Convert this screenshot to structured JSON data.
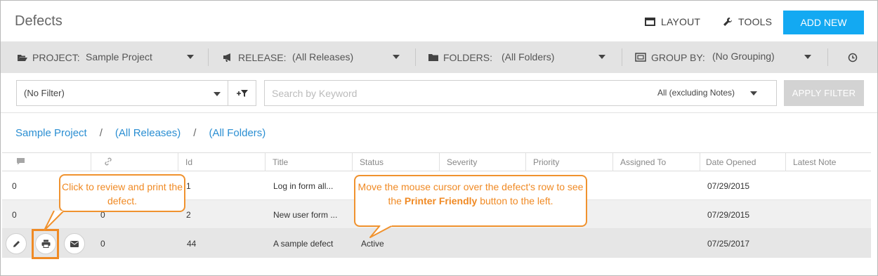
{
  "header": {
    "title": "Defects",
    "layout_label": "LAYOUT",
    "tools_label": "TOOLS",
    "add_new_label": "ADD NEW"
  },
  "filter_bar": {
    "project": {
      "label": "PROJECT:",
      "value": "Sample Project",
      "icon": "folder-open-icon"
    },
    "release": {
      "label": "RELEASE:",
      "value": "(All Releases)",
      "icon": "megaphone-icon"
    },
    "folders": {
      "label": "FOLDERS:",
      "value": "(All Folders)",
      "icon": "folder-icon"
    },
    "group_by": {
      "label": "GROUP BY:",
      "value": "(No Grouping)",
      "icon": "group-icon"
    },
    "history_icon": "clock-icon"
  },
  "search": {
    "filter_value": "(No Filter)",
    "placeholder": "Search by Keyword",
    "scope_value": "All (excluding Notes)",
    "apply_label": "APPLY FILTER"
  },
  "breadcrumb": {
    "items": [
      "Sample Project",
      "(All Releases)",
      "(All Folders)"
    ],
    "separator": "/"
  },
  "grid": {
    "columns": [
      "",
      "",
      "Id",
      "Title",
      "Status",
      "Severity",
      "Priority",
      "Assigned To",
      "Date Opened",
      "Latest Note"
    ],
    "rows": [
      {
        "comments": "0",
        "links": "",
        "id": "1",
        "title": "Log in form all...",
        "status": "",
        "date_opened": "07/29/2015"
      },
      {
        "comments": "0",
        "links": "0",
        "id": "2",
        "title": "New user form ...",
        "status": "",
        "date_opened": "07/29/2015"
      },
      {
        "comments": "",
        "links": "0",
        "id": "44",
        "title": "A sample defect",
        "status": "Active",
        "date_opened": "07/25/2017"
      }
    ]
  },
  "callouts": {
    "print_tip": "Click to review and print the defect.",
    "hover_tip_pre": "Move the mouse cursor over the defect's row to see the ",
    "hover_tip_bold": "Printer Friendly",
    "hover_tip_post": " button to the left."
  },
  "colors": {
    "accent": "#13a9f2",
    "callout": "#f08a24",
    "link": "#2a8ed2"
  }
}
